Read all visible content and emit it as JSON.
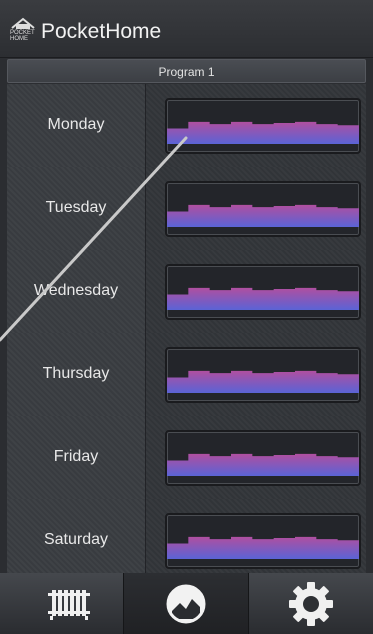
{
  "app": {
    "title": "PocketHome",
    "logo_text_line1": "POCKET",
    "logo_text_line2": "HOME"
  },
  "program": {
    "label": "Program 1"
  },
  "days": [
    {
      "name": "Monday"
    },
    {
      "name": "Tuesday"
    },
    {
      "name": "Wednesday"
    },
    {
      "name": "Thursday"
    },
    {
      "name": "Friday"
    },
    {
      "name": "Saturday"
    }
  ],
  "schedule_profile": [
    0.25,
    0.55,
    0.45,
    0.55,
    0.45,
    0.5,
    0.55,
    0.45,
    0.4
  ],
  "colors": {
    "warm": "#b04fa0",
    "cool": "#5a63d6"
  },
  "bottom_nav": [
    {
      "icon": "radiator-icon",
      "active": false
    },
    {
      "icon": "thermostat-dial-icon",
      "active": true
    },
    {
      "icon": "gear-icon",
      "active": false
    }
  ]
}
